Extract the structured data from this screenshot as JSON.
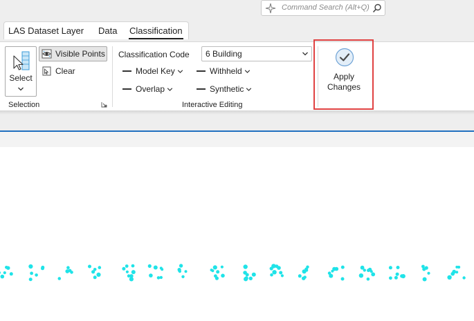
{
  "search": {
    "placeholder": "Command Search (Alt+Q)"
  },
  "tabs": [
    {
      "label": "LAS Dataset Layer",
      "active": false
    },
    {
      "label": "Data",
      "active": false
    },
    {
      "label": "Classification",
      "active": true
    }
  ],
  "ribbon": {
    "selection": {
      "select_label": "Select",
      "visible_points_label": "Visible Points",
      "clear_label": "Clear",
      "group_label": "Selection"
    },
    "editing": {
      "classification_code_label": "Classification Code",
      "classification_code_value": "6 Building",
      "model_key_label": "Model Key",
      "withheld_label": "Withheld",
      "overlap_label": "Overlap",
      "synthetic_label": "Synthetic",
      "group_label": "Interactive Editing"
    },
    "apply": {
      "label_line1": "Apply",
      "label_line2": "Changes"
    }
  },
  "colors": {
    "accent": "#1f6fbf",
    "highlight_box": "#e04141",
    "points": "#1fe3e8"
  },
  "icons": {
    "search": "magnifier-icon",
    "sparkle": "sparkle-icon",
    "select": "cursor-select-icon",
    "visible_points": "visible-points-icon",
    "clear": "clear-selection-icon",
    "apply": "checkmark-circle-icon"
  }
}
